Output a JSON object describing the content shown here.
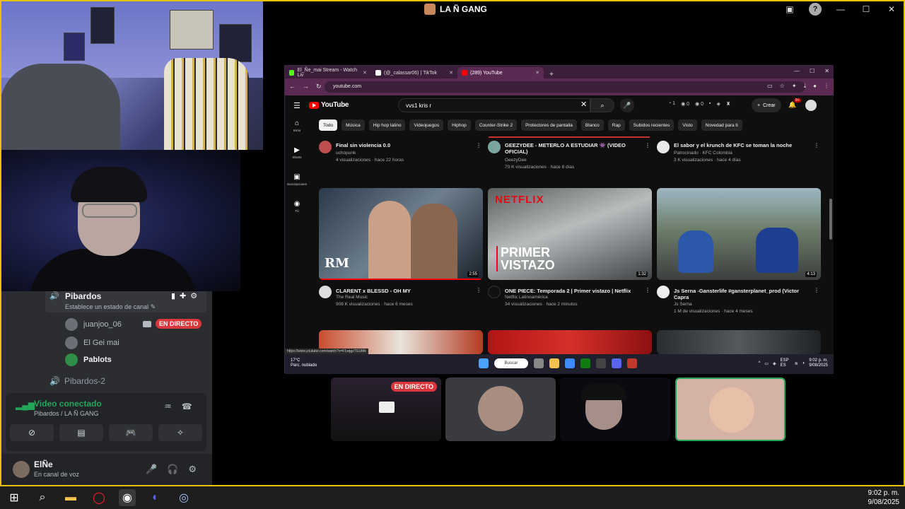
{
  "window": {
    "title": "LA Ñ GANG"
  },
  "discord": {
    "voice_channel": {
      "name": "Pibardos",
      "status_placeholder": "Establece un estado de canal",
      "members": [
        {
          "name": "juanjoo_06",
          "live": true
        },
        {
          "name": "El Gei mai",
          "live": false
        },
        {
          "name": "Pablots",
          "live": false,
          "bold": true
        }
      ]
    },
    "second_channel": "Pibardos-2",
    "live_label": "EN DIRECTO",
    "connection": {
      "title": "Video conectado",
      "subtitle": "Pibardos / LA Ñ GANG"
    },
    "user": {
      "name": "ElÑe",
      "status": "En canal de voz"
    }
  },
  "browser": {
    "tabs": [
      {
        "label": "El_Ñe_mai Stream - Watch Liv",
        "color": "#53fc18",
        "active": false
      },
      {
        "label": "(@_calassar06) | TikTok",
        "color": "#ffffff",
        "active": false
      },
      {
        "label": "(289) YouTube",
        "color": "#ff0000",
        "active": true
      }
    ],
    "url": "youtube.com",
    "status_url": "https://www.youtube.com/watch?v=F1sqgzTGUMk"
  },
  "youtube": {
    "logo": "YouTube",
    "search_value": "vvs1 kris r",
    "create_label": "Crear",
    "notifications": "9+",
    "sidebar": [
      {
        "icon": "⌂",
        "label": "Inicio"
      },
      {
        "icon": "▶",
        "label": "Shorts"
      },
      {
        "icon": "▣",
        "label": "Suscripciones"
      },
      {
        "icon": "◉",
        "label": "Tú"
      }
    ],
    "chips": [
      "Todo",
      "Música",
      "Hip hop latino",
      "Videojuegos",
      "Hiphop",
      "Counter-Strike 2",
      "Protectores de pantalla",
      "Blanco",
      "Rap",
      "Subidos recientes",
      "Visto",
      "Novedad para ti"
    ],
    "top_videos": [
      {
        "title": "Final sin violencia 0.0",
        "channel": "uchopunk",
        "meta": "4 visualizaciones · hace 22 horas"
      },
      {
        "title": "GEEZYDEE - METERLO A ESTUDIAR 👾 (VIDEO OFICIAL)",
        "channel": "GeezyDee",
        "meta": "70 K visualizaciones · hace 8 días"
      },
      {
        "title": "El sabor y el krunch de KFC se toman la noche",
        "channel": "Patrocinado · KFC Colombia",
        "meta": "3 K visualizaciones · hace 4 días"
      }
    ],
    "videos": [
      {
        "title": "CLARENT x BLESSD - OH MY",
        "channel": "The Real Music",
        "meta": "908 K visualizaciones · hace 6 meses",
        "duration": "2:55",
        "thumb_text": "RM"
      },
      {
        "title": "ONE PIECE: Temporada 2 | Primer vistazo | Netflix",
        "channel": "Netflix Latinoamérica",
        "meta": "34 visualizaciones · hace 2 minutos",
        "duration": "1:32",
        "thumb_text": "PRIMER VISTAZO",
        "brand": "NETFLIX"
      },
      {
        "title": "Js Serna -Gansterlife #gansterplanet_prod (Victor Capra",
        "channel": "Js Serna",
        "meta": "1 M de visualizaciones · hace 4 meses",
        "duration": "4:13"
      }
    ]
  },
  "inner_taskbar": {
    "weather_temp": "17°C",
    "weather_desc": "Parc. nublado",
    "search": "Buscar",
    "lang": "ESP ES",
    "time": "9:02 p. m.",
    "date": "9/08/2025"
  },
  "tiles": {
    "live_label": "EN DIRECTO"
  },
  "taskbar": {
    "time": "9:02 p. m.",
    "date": "9/08/2025"
  }
}
